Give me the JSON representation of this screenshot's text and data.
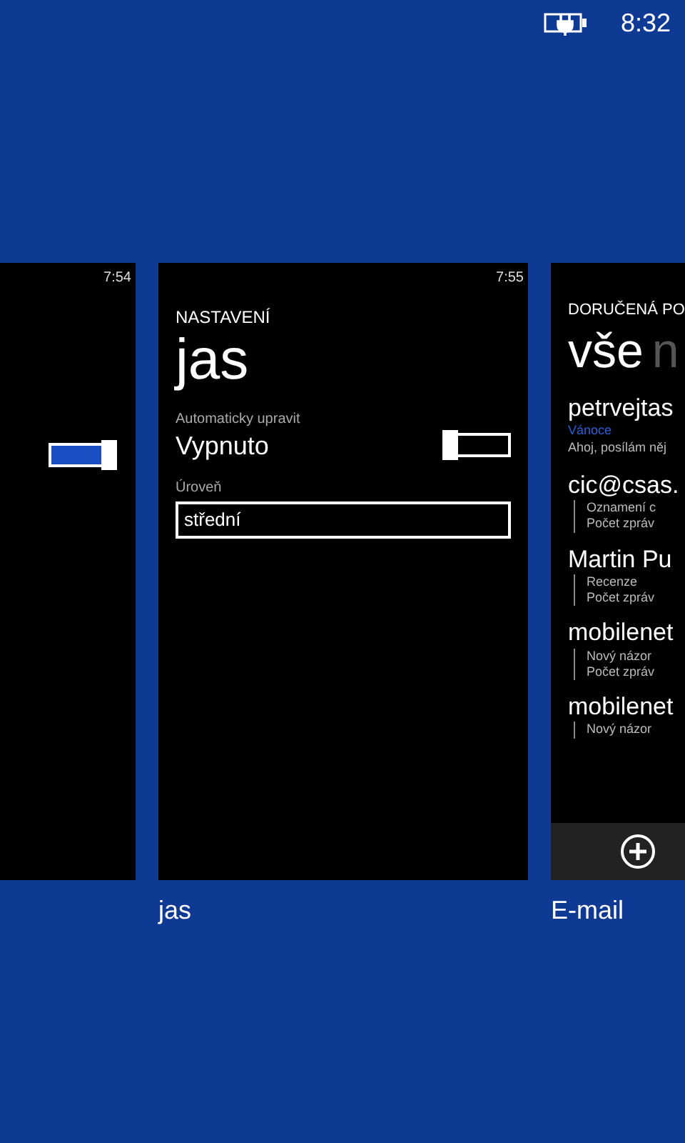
{
  "status_bar": {
    "charging": true,
    "time": "8:32"
  },
  "cards": [
    {
      "kind": "partial",
      "time": "7:54",
      "toggle_on": true
    },
    {
      "kind": "settings",
      "time": "7:55",
      "label": "jas",
      "header": "NASTAVENÍ",
      "title": "jas",
      "toggle_label": "Automaticky upravit",
      "toggle_value": "Vypnuto",
      "toggle_on": false,
      "level_label": "Úroveň",
      "level_value": "střední"
    },
    {
      "kind": "mail",
      "label": "E-mail",
      "header": "DORUČENÁ PO",
      "pivots": [
        {
          "label": "vše",
          "selected": true
        },
        {
          "label": "n",
          "selected": false
        }
      ],
      "messages": [
        {
          "kind": "plain",
          "sender": "petrvejtas",
          "subject": "Vánoce",
          "preview": "Ahoj, posílám něj"
        },
        {
          "kind": "thread",
          "sender": "cic@csas.",
          "lines": [
            "Oznamení c",
            "Počet zpráv"
          ]
        },
        {
          "kind": "thread",
          "sender": "Martin Pu",
          "lines": [
            "Recenze",
            "Počet zpráv"
          ]
        },
        {
          "kind": "thread",
          "sender": "mobilenet",
          "lines": [
            "Nový názor",
            "Počet zpráv"
          ]
        },
        {
          "kind": "thread",
          "sender": "mobilenet",
          "lines": [
            "Nový názor"
          ]
        }
      ]
    }
  ]
}
